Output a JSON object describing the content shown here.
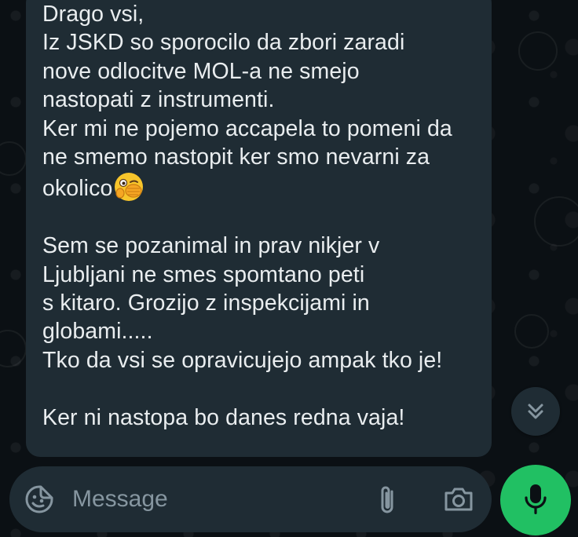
{
  "message": {
    "lines": [
      "Drago vsi,",
      "Iz JSKD so sporocilo da zbori zaradi",
      "nove odlocitve MOL-a ne smejo",
      "nastopati z instrumenti.",
      "Ker mi ne pojemo accapela to pomeni da",
      "ne smemo nastopit ker smo nevarni za",
      "okolico",
      "",
      "Sem se pozanimal in prav nikjer v",
      "Ljubljani ne smes spomtano peti",
      "s kitaro. Grozijo z inspekcijami in",
      "globami.....",
      "Tko da vsi se opravicujejo ampak tko je!",
      "",
      "Ker ni nastopa bo danes redna vaja!"
    ],
    "emoji": "face-with-hand-over-mouth-emoji"
  },
  "composer": {
    "placeholder": "Message",
    "value": ""
  },
  "icons": {
    "scroll": "double-chevron-down-icon",
    "sticker": "sticker-icon",
    "attach": "paperclip-icon",
    "camera": "camera-icon",
    "mic": "microphone-icon"
  },
  "colors": {
    "background": "#0b1014",
    "bubble": "#1f2c34",
    "text": "#e9edef",
    "muted": "#8696a0",
    "accent": "#21c063"
  }
}
